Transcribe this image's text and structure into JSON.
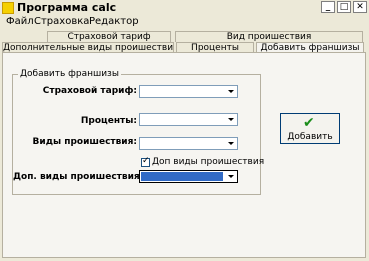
{
  "window": {
    "title": "Программа calc",
    "caption_buttons": [
      "_",
      "□",
      "✕"
    ]
  },
  "menu": [
    {
      "label": "Файл",
      "mnemonic": "Ф"
    },
    {
      "label": "Страховка",
      "mnemonic": "С"
    },
    {
      "label": "Редактор",
      "mnemonic": "Р"
    }
  ],
  "tabs_top": [
    {
      "label": "Страховой тариф"
    },
    {
      "label": "Вид проишествия"
    }
  ],
  "tabs_bottom": [
    {
      "label": "Дополнительные виды проишествия"
    },
    {
      "label": "Проценты"
    },
    {
      "label": "Добавить франшизы",
      "active": true
    }
  ],
  "group": {
    "title": "Добавить франшизы"
  },
  "fields": {
    "tariff_label": "Страховой тариф:",
    "percent_label": "Проценты:",
    "incident_label": "Виды проишествия:",
    "extra_incident_label": "Доп. виды проишествия:"
  },
  "checkbox": {
    "label": "Доп виды проишествия",
    "checked": true
  },
  "add_button": {
    "label": "Добавить",
    "icon": "green-check-icon"
  },
  "colors": {
    "selection": "#316ac5",
    "check_green": "#1b8d1b"
  }
}
